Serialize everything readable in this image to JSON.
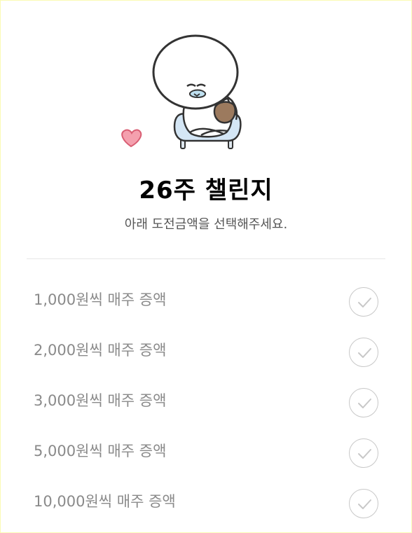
{
  "header": {
    "illustration": "character-sitting-on-chair-with-heart",
    "title": "26주 챌린지",
    "subtitle": "아래 도전금액을 선택해주세요."
  },
  "options": [
    {
      "label": "1,000원씩 매주 증액",
      "icon": "check-icon",
      "selected": false
    },
    {
      "label": "2,000원씩 매주 증액",
      "icon": "check-icon",
      "selected": false
    },
    {
      "label": "3,000원씩 매주 증액",
      "icon": "check-icon",
      "selected": false
    },
    {
      "label": "5,000원씩 매주 증액",
      "icon": "check-icon",
      "selected": false
    },
    {
      "label": "10,000원씩 매주 증액",
      "icon": "check-icon",
      "selected": false
    }
  ],
  "colors": {
    "title": "#000000",
    "subtitle": "#555555",
    "option_text": "#8a8a8a",
    "check_stroke": "#c8c8c8",
    "heart": "#f28b9c",
    "chair": "#d4e6f5",
    "frame_border": "#fafab4"
  }
}
